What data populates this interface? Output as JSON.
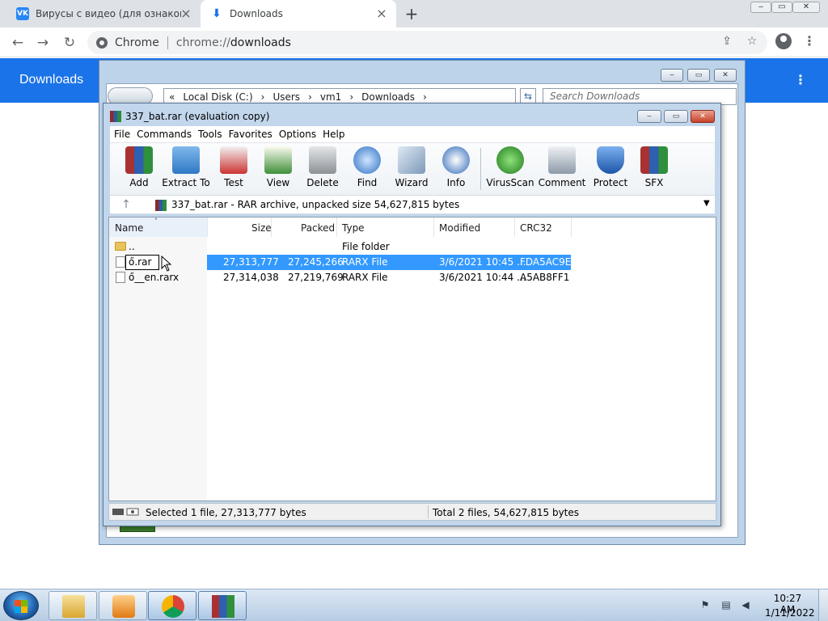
{
  "browser": {
    "tabs": [
      {
        "label": "Вирусы с видео (для ознакомле",
        "favicon": "vk-icon",
        "favicon_text": "VK",
        "color": "#2787f5"
      },
      {
        "label": "Downloads",
        "favicon": "download-icon",
        "favicon_text": "⬇"
      }
    ],
    "omnibox": {
      "chip": "Chrome",
      "url_scheme": "chrome://",
      "url_path": "downloads"
    },
    "window_controls": {
      "minimize": "‒",
      "maximize": "▭",
      "close": "✕"
    }
  },
  "downloads_page": {
    "title": "Downloads",
    "header_color": "#1a73e8"
  },
  "explorer": {
    "breadcrumb": [
      "«",
      "Local Disk (C:)",
      "›",
      "Users",
      "›",
      "vm1",
      "›",
      "Downloads",
      "›"
    ],
    "search_placeholder": "Search Downloads"
  },
  "winrar": {
    "title": "337_bat.rar (evaluation copy)",
    "menu": [
      "File",
      "Commands",
      "Tools",
      "Favorites",
      "Options",
      "Help"
    ],
    "toolbar": [
      {
        "label": "Add",
        "icon": "add-icon"
      },
      {
        "label": "Extract To",
        "icon": "extract-to-icon"
      },
      {
        "label": "Test",
        "icon": "test-icon"
      },
      {
        "label": "View",
        "icon": "view-icon"
      },
      {
        "label": "Delete",
        "icon": "delete-icon"
      },
      {
        "label": "Find",
        "icon": "find-icon"
      },
      {
        "label": "Wizard",
        "icon": "wizard-icon"
      },
      {
        "label": "Info",
        "icon": "info-icon"
      },
      {
        "label": "VirusScan",
        "icon": "virusscan-icon"
      },
      {
        "label": "Comment",
        "icon": "comment-icon"
      },
      {
        "label": "Protect",
        "icon": "protect-icon"
      },
      {
        "label": "SFX",
        "icon": "sfx-icon"
      }
    ],
    "path_text": "337_bat.rar - RAR archive, unpacked size 54,627,815 bytes",
    "columns": [
      "Name",
      "Size",
      "Packed",
      "Type",
      "Modified",
      "CRC32"
    ],
    "rows": [
      {
        "name": "..",
        "size": "",
        "packed": "",
        "type": "File folder",
        "modified": "",
        "crc": "",
        "selected": false
      },
      {
        "name": "ő.rar",
        "size": "27,313,777",
        "packed": "27,245,266",
        "type": "RARX File",
        "modified": "3/6/2021 10:45 ...",
        "crc": "FDA5AC9E",
        "selected": true
      },
      {
        "name": "ő__en.rarx",
        "size": "27,314,038",
        "packed": "27,219,769",
        "type": "RARX File",
        "modified": "3/6/2021 10:44 ...",
        "crc": "A5AB8FF1",
        "selected": false
      }
    ],
    "status_left": "Selected 1 file, 27,313,777 bytes",
    "status_right": "Total 2 files, 54,627,815 bytes",
    "selection_color": "#3399ff"
  },
  "taskbar": {
    "apps": [
      "explorer-icon",
      "media-player-icon",
      "chrome-icon",
      "winrar-icon"
    ],
    "clock_time": "10:27 AM",
    "clock_date": "1/11/2022"
  }
}
